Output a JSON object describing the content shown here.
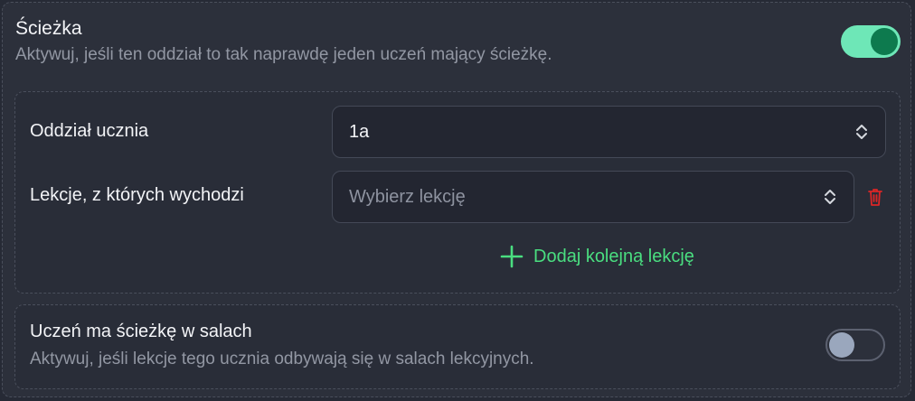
{
  "path": {
    "title": "Ścieżka",
    "description": "Aktywuj, jeśli ten oddział to tak naprawdę jeden uczeń mający ścieżkę.",
    "enabled": true
  },
  "form": {
    "class_label": "Oddział ucznia",
    "class_value": "1a",
    "lessons_label": "Lekcje, z których wychodzi",
    "lessons_placeholder": "Wybierz lekcję",
    "add_lesson_label": "Dodaj kolejną lekcję"
  },
  "rooms": {
    "title": "Uczeń ma ścieżkę w salach",
    "description": "Aktywuj, jeśli lekcje tego ucznia odbywają się w salach lekcyjnych.",
    "enabled": false
  },
  "colors": {
    "accent_green": "#4ade80",
    "toggle_on_track": "#6ee7b7",
    "toggle_on_knob": "#0d7a4e",
    "danger_red": "#dc2626"
  },
  "icons": {
    "select_chevron": "chevron-up-down-icon",
    "delete": "trash-icon",
    "add": "plus-icon"
  }
}
